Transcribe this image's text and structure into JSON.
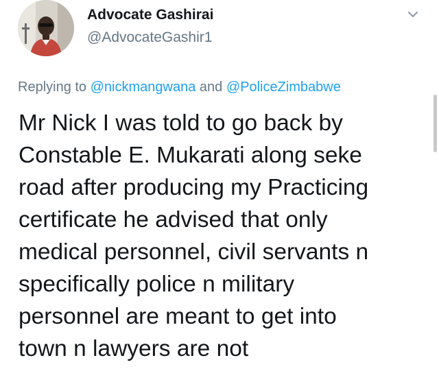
{
  "tweet": {
    "author": {
      "name": "Advocate Gashirai",
      "handle": "@AdvocateGashir1",
      "avatar_icon": "user-avatar-photo"
    },
    "menu_icon": "chevron-down-icon",
    "reply": {
      "prefix": "Replying to ",
      "mentions": [
        "@nickmangwana",
        "@PoliceZimbabwe"
      ],
      "joiner": " and "
    },
    "text_lines": [
      "Mr Nick I was told to go back by",
      "Constable E. Mukarati along seke",
      "road after producing my Practicing",
      "certificate he advised that only",
      "medical personnel, civil servants n",
      "specifically police n military",
      "personnel are meant to get into",
      "town n lawyers are not"
    ]
  },
  "colors": {
    "text": "#14171a",
    "secondary": "#657786",
    "link": "#1da1f2",
    "background": "#ffffff"
  }
}
